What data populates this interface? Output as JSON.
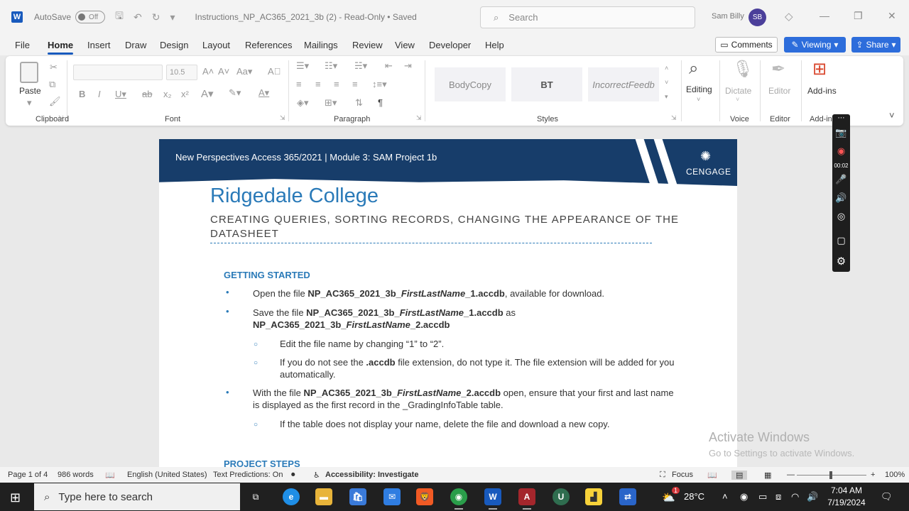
{
  "titlebar": {
    "autosave_label": "AutoSave",
    "autosave_state": "Off",
    "doc_title": "Instructions_NP_AC365_2021_3b (2)  -  Read-Only  •  Saved",
    "search_placeholder": "Search",
    "user_name": "Sam Billy",
    "user_initials": "SB"
  },
  "tabs": [
    "File",
    "Home",
    "Insert",
    "Draw",
    "Design",
    "Layout",
    "References",
    "Mailings",
    "Review",
    "View",
    "Developer",
    "Help"
  ],
  "active_tab": "Home",
  "actions": {
    "comments": "Comments",
    "viewing": "Viewing",
    "share": "Share"
  },
  "ribbon": {
    "paste": "Paste",
    "font_size": "10.5",
    "groups": [
      "Clipboard",
      "Font",
      "Paragraph",
      "Styles",
      "Voice",
      "Editor",
      "Add-ins"
    ],
    "styles": [
      "BodyCopy",
      "BT",
      "IncorrectFeedb"
    ],
    "editing": "Editing",
    "dictate": "Dictate",
    "editor": "Editor",
    "addins": "Add-ins"
  },
  "document": {
    "banner": "New Perspectives Access 365/2021  |  Module 3: SAM Project 1b",
    "brand": "CENGAGE",
    "title": "Ridgedale College",
    "subtitle": "CREATING QUERIES, SORTING RECORDS, CHANGING THE APPEARANCE OF THE DATASHEET",
    "section1": "GETTING STARTED",
    "b1_pre": "Open the file ",
    "b1_file_a": "NP_AC365_2021_3b_",
    "b1_file_b": "FirstLastName",
    "b1_file_c": "_1.accdb",
    "b1_post": ", available for download.",
    "b2_pre": "Save the file ",
    "b2_file_a": "NP_AC365_2021_3b_",
    "b2_file_b": "FirstLastName",
    "b2_file_c": "_1.accdb",
    "b2_mid": " as",
    "b2_file2_a": "NP_AC365_2021_3b_",
    "b2_file2_b": "FirstLastName",
    "b2_file2_c": "_2.accdb",
    "s1": "Edit the file name by changing “1” to “2”.",
    "s2_pre": "If you do not see the ",
    "s2_bold": ".accdb",
    "s2_post": " file extension, do not type it. The file extension will be added for you automatically.",
    "b3_pre": "With the file ",
    "b3_file_a": "NP_AC365_2021_3b_",
    "b3_file_b": "FirstLastName",
    "b3_file_c": "_2.accdb",
    "b3_post": " open, ensure that your first and last name is displayed as the first record in the _GradingInfoTable table.",
    "s3": "If the table does not display your name, delete the file and download a new copy.",
    "section2": "PROJECT STEPS"
  },
  "watermark": {
    "line1": "Activate Windows",
    "line2": "Go to Settings to activate Windows."
  },
  "recorder": {
    "time": "00:02"
  },
  "statusbar": {
    "page": "Page 1 of 4",
    "words": "986 words",
    "language": "English (United States)",
    "predictions": "Text Predictions: On",
    "accessibility": "Accessibility: Investigate",
    "focus": "Focus",
    "zoom": "100%"
  },
  "taskbar": {
    "search_placeholder": "Type here to search",
    "temperature": "28°C",
    "weather_badge": "1",
    "time": "7:04 AM",
    "date": "7/19/2024"
  },
  "colors": {
    "word_blue": "#185abd",
    "banner_navy": "#173d6a",
    "heading_blue": "#2a7ab8",
    "share_blue": "#2d6ddb"
  }
}
